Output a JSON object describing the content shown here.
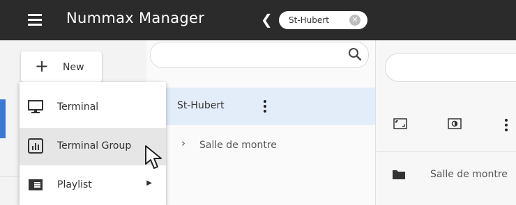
{
  "header": {
    "app_title": "Nummax Manager",
    "chip_label": "St-Hubert"
  },
  "new_button": {
    "label": "New"
  },
  "menu": {
    "items": [
      {
        "label": "Terminal",
        "icon": "monitor-icon"
      },
      {
        "label": "Terminal Group",
        "icon": "chart-box-icon"
      },
      {
        "label": "Playlist",
        "icon": "playlist-icon",
        "has_submenu": true
      }
    ]
  },
  "tree": {
    "selected": "St-Hubert",
    "children": [
      "Salle de montre"
    ]
  },
  "content": {
    "folder_label": "Salle de montre"
  },
  "colors": {
    "topbar": "#2b2b2b",
    "accent": "#3a78d6",
    "selected_row": "#e3ecf9"
  }
}
